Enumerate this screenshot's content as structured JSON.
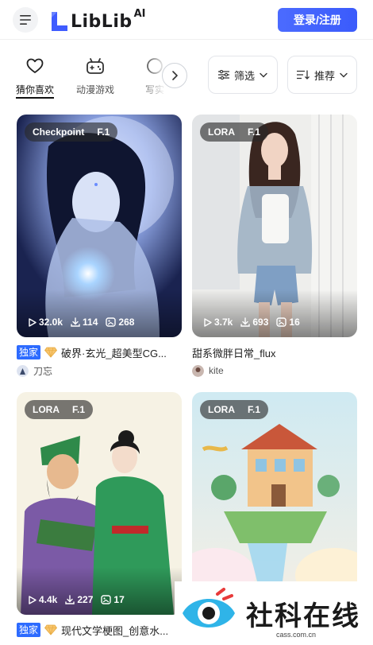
{
  "header": {
    "brand": "LiblibAI",
    "brand_prefix": "LiblLib",
    "brand_sup": "AI",
    "login_label": "登录/注册",
    "accent_color": "#3b5bfb"
  },
  "tabs": [
    {
      "label": "猜你喜欢",
      "icon": "heart-icon",
      "active": true
    },
    {
      "label": "动漫游戏",
      "icon": "gamepad-icon",
      "active": false
    },
    {
      "label": "写实",
      "icon": "camera-icon",
      "active": false
    }
  ],
  "filters": {
    "filter_label": "筛选",
    "sort_label": "推荐"
  },
  "cards": [
    {
      "badge_type": "Checkpoint",
      "badge_base": "F.1",
      "views": "32.0k",
      "downloads": "114",
      "images": "268",
      "tag": "独家",
      "title": "破界·玄光_超美型CG...",
      "author": "刀忘"
    },
    {
      "badge_type": "LORA",
      "badge_base": "F.1",
      "views": "3.7k",
      "downloads": "693",
      "images": "16",
      "tag": "",
      "title": "甜系微胖日常_flux",
      "author": "kite"
    },
    {
      "badge_type": "LORA",
      "badge_base": "F.1",
      "views": "4.4k",
      "downloads": "227",
      "images": "17",
      "tag": "独家",
      "title": "现代文学梗图_创意水...",
      "author": ""
    },
    {
      "badge_type": "LORA",
      "badge_base": "F.1",
      "views": "",
      "downloads": "",
      "images": "",
      "tag": "",
      "title": "",
      "author": ""
    }
  ],
  "watermark": {
    "text": "社科在线",
    "url": "cass.com.cn"
  }
}
